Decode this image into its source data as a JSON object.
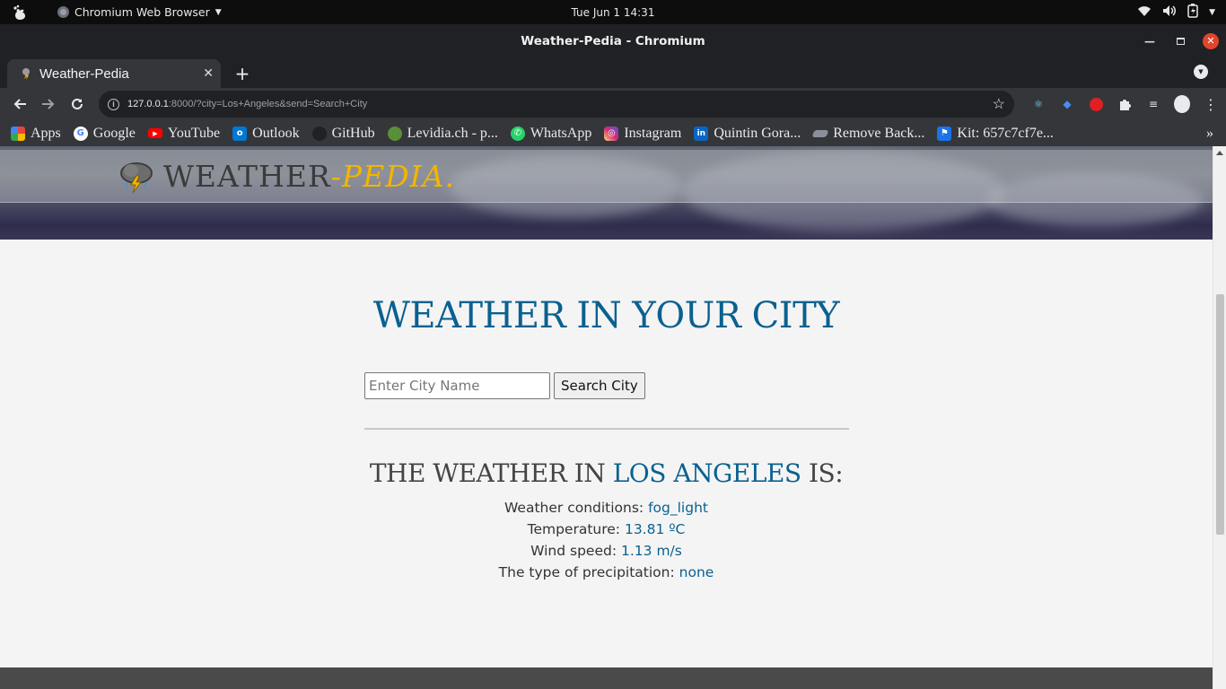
{
  "system": {
    "app_name": "Chromium Web Browser",
    "clock": "Tue Jun 1  14:31"
  },
  "window": {
    "title": "Weather-Pedia - Chromium"
  },
  "tabs": [
    {
      "label": "Weather-Pedia"
    }
  ],
  "address": {
    "host": "127.0.0.1",
    "rest": ":8000/?city=Los+Angeles&send=Search+City"
  },
  "bookmarks": [
    {
      "label": "Apps",
      "icon": "apps-grid-icon",
      "color": "#e8453c"
    },
    {
      "label": "Google",
      "icon": "google-icon",
      "color": "#ffffff"
    },
    {
      "label": "YouTube",
      "icon": "youtube-icon",
      "color": "#ff0000"
    },
    {
      "label": "Outlook",
      "icon": "outlook-icon",
      "color": "#0078d4"
    },
    {
      "label": "GitHub",
      "icon": "github-icon",
      "color": "#202124"
    },
    {
      "label": "Levidia.ch - p...",
      "icon": "levidia-icon",
      "color": "#5a8f3a"
    },
    {
      "label": "WhatsApp",
      "icon": "whatsapp-icon",
      "color": "#25d366"
    },
    {
      "label": "Instagram",
      "icon": "instagram-icon",
      "color": "#d62976"
    },
    {
      "label": "Quintin Gora...",
      "icon": "linkedin-icon",
      "color": "#0a66c2"
    },
    {
      "label": "Remove Back...",
      "icon": "remove-bg-icon",
      "color": "#8a8f99"
    },
    {
      "label": "Kit: 657c7cf7e...",
      "icon": "flag-icon",
      "color": "#1a73e8"
    }
  ],
  "page": {
    "brand_main": "WEATHER",
    "brand_accent": "-PEDIA.",
    "heading": "WEATHER IN YOUR CITY",
    "search": {
      "placeholder": "Enter City Name",
      "button_label": "Search City"
    },
    "result": {
      "prefix": "THE WEATHER IN ",
      "city": "LOS ANGELES",
      "suffix": " IS:",
      "rows": [
        {
          "label": "Weather conditions: ",
          "value": "fog_light"
        },
        {
          "label": "Temperature: ",
          "value": "13.81 ºC"
        },
        {
          "label": "Wind speed: ",
          "value": "1.13 m/s"
        },
        {
          "label": "The type of precipitation: ",
          "value": "none"
        }
      ]
    }
  },
  "colors": {
    "accent_blue": "#0a6190",
    "brand_yellow": "#f5b400"
  }
}
